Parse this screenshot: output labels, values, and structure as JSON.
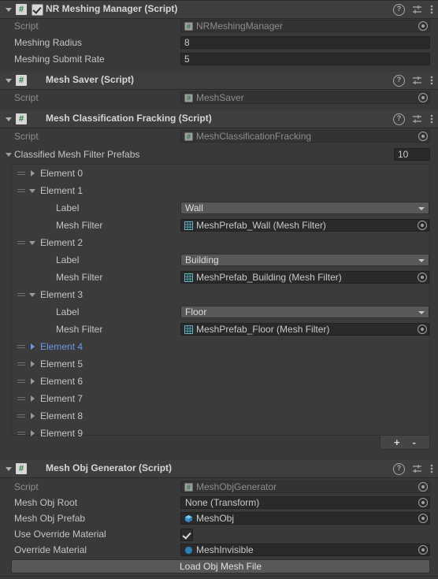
{
  "components": [
    {
      "title": "NR Meshing Manager (Script)",
      "has_checkbox": true,
      "script_icon": "csharp-script-icon",
      "rows": [
        {
          "label": "Script",
          "type": "object",
          "value": "NRMeshingManager",
          "icon": "csharp-script-icon",
          "disabled": true
        },
        {
          "label": "Meshing Radius",
          "type": "text",
          "value": "8"
        },
        {
          "label": "Meshing Submit Rate",
          "type": "text",
          "value": "5"
        }
      ]
    },
    {
      "title": "Mesh Saver (Script)",
      "has_checkbox": false,
      "script_icon": "csharp-script-icon",
      "rows": [
        {
          "label": "Script",
          "type": "object",
          "value": "MeshSaver",
          "icon": "csharp-script-icon",
          "disabled": true
        }
      ]
    },
    {
      "title": "Mesh Classification Fracking (Script)",
      "has_checkbox": false,
      "script_icon": "csharp-script-icon",
      "rows": [
        {
          "label": "Script",
          "type": "object",
          "value": "MeshClassificationFracking",
          "icon": "csharp-script-icon",
          "disabled": true
        }
      ]
    },
    {
      "title": "Mesh Obj Generator (Script)",
      "has_checkbox": false,
      "script_icon": "csharp-script-icon",
      "rows": [
        {
          "label": "Script",
          "type": "object",
          "value": "MeshObjGenerator",
          "icon": "csharp-script-icon",
          "disabled": true
        },
        {
          "label": "Mesh Obj Root",
          "type": "object",
          "value": "None (Transform)",
          "icon": "none"
        },
        {
          "label": "Mesh Obj Prefab",
          "type": "object",
          "value": "MeshObj",
          "icon": "prefab-cube-icon"
        },
        {
          "label": "Use Override Material",
          "type": "checkbox",
          "value": true
        },
        {
          "label": "Override Material",
          "type": "object",
          "value": "MeshInvisible",
          "icon": "material-sphere-icon"
        }
      ],
      "button_label": "Load Obj Mesh File"
    }
  ],
  "array": {
    "label": "Classified Mesh Filter Prefabs",
    "size": "10",
    "sub_labels": {
      "label": "Label",
      "mesh_filter": "Mesh Filter"
    },
    "add_label": "+",
    "remove_label": "-",
    "elements": [
      {
        "name": "Element 0",
        "expanded": false,
        "selected": false
      },
      {
        "name": "Element 1",
        "expanded": true,
        "selected": false,
        "label_value": "Wall",
        "mesh_filter_value": "MeshPrefab_Wall (Mesh Filter)"
      },
      {
        "name": "Element 2",
        "expanded": true,
        "selected": false,
        "label_value": "Building",
        "mesh_filter_value": "MeshPrefab_Building (Mesh Filter)"
      },
      {
        "name": "Element 3",
        "expanded": true,
        "selected": false,
        "label_value": "Floor",
        "mesh_filter_value": "MeshPrefab_Floor (Mesh Filter)"
      },
      {
        "name": "Element 4",
        "expanded": false,
        "selected": true
      },
      {
        "name": "Element 5",
        "expanded": false,
        "selected": false
      },
      {
        "name": "Element 6",
        "expanded": false,
        "selected": false
      },
      {
        "name": "Element 7",
        "expanded": false,
        "selected": false
      },
      {
        "name": "Element 8",
        "expanded": false,
        "selected": false
      },
      {
        "name": "Element 9",
        "expanded": false,
        "selected": false
      }
    ]
  },
  "header_icons": {
    "help": "?",
    "preset": "preset-icon",
    "menu": "more-menu-icon"
  },
  "colors": {
    "panel_bg": "#393939",
    "header_bg": "#3e3e3e",
    "field_bg": "#2a2a2a",
    "dropdown_bg": "#585858",
    "selected_blue": "#6a9ae8",
    "script_green": "#2b7a3d",
    "mesh_filter_teal": "#5fb3c4",
    "prefab_blue": "#4fa8e0"
  }
}
